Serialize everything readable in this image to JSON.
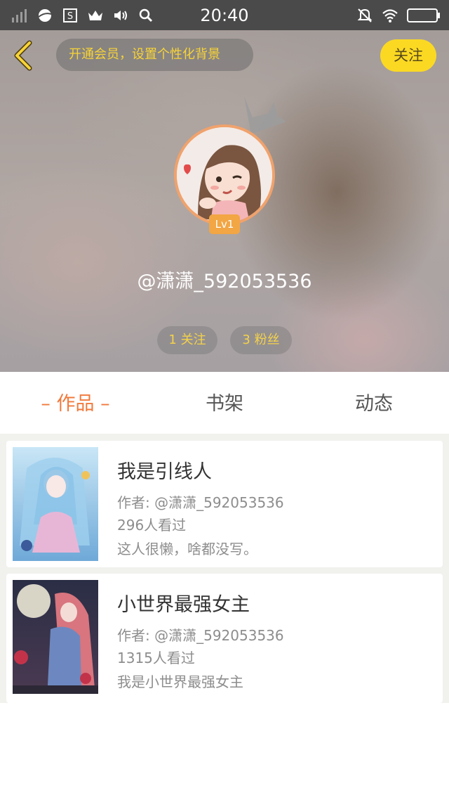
{
  "status_bar": {
    "time": "20:40"
  },
  "header": {
    "vip_prompt": "开通会员，设置个性化背景",
    "follow_label": "关注",
    "level": "Lv1",
    "username": "@潇潇_592053536",
    "following_count": "1 关注",
    "fans_count": "3 粉丝"
  },
  "tabs": [
    {
      "label": "– 作品 –",
      "active": true
    },
    {
      "label": "书架",
      "active": false
    },
    {
      "label": "动态",
      "active": false
    }
  ],
  "works": [
    {
      "title": "我是引线人",
      "author": "作者: @潇潇_592053536",
      "views": "296人看过",
      "description": "这人很懒，啥都没写。"
    },
    {
      "title": "小世界最强女主",
      "author": "作者: @潇潇_592053536",
      "views": "1315人看过",
      "description": "我是小世界最强女主"
    }
  ],
  "colors": {
    "accent_orange": "#f07a3c",
    "follow_yellow": "#fbd923",
    "vip_text": "#f7d337",
    "status_bar_bg": "#4a4a4a"
  }
}
